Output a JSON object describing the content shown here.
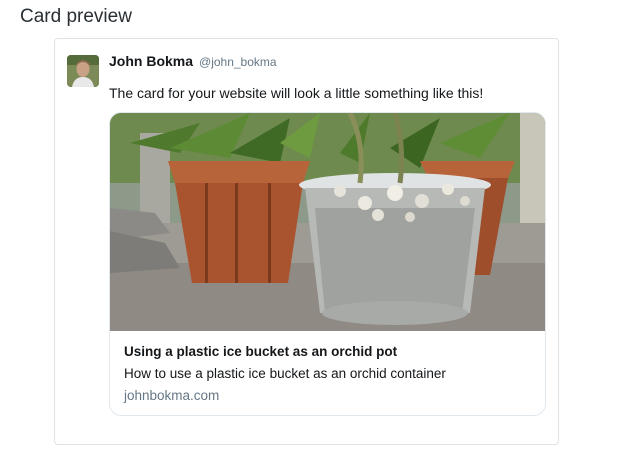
{
  "page": {
    "title": "Card preview"
  },
  "tweet": {
    "author_name": "John Bokma",
    "author_handle": "@john_bokma",
    "text": "The card for your website will look a little something like this!"
  },
  "card": {
    "title": "Using a plastic ice bucket as an orchid pot",
    "description": "How to use a plastic ice bucket as an orchid container",
    "domain": "johnbokma.com"
  }
}
